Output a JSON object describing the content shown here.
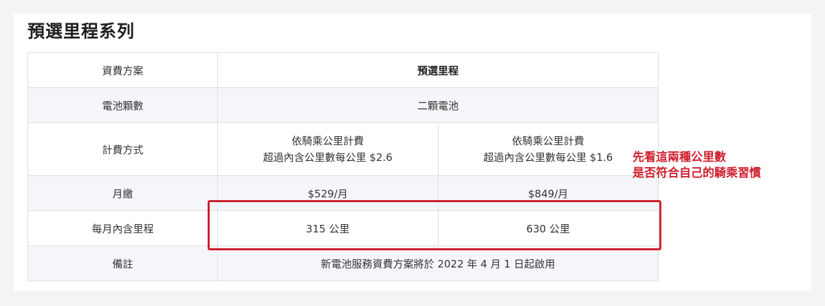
{
  "title": "預選里程系列",
  "table": {
    "rows": {
      "plan": {
        "label": "資費方案",
        "value": "預選里程"
      },
      "battery": {
        "label": "電池顆數",
        "value": "二顆電池"
      },
      "billing": {
        "label": "計費方式",
        "col1_line1": "依騎乘公里計費",
        "col1_line2": "超過內含公里數每公里 $2.6",
        "col2_line1": "依騎乘公里計費",
        "col2_line2": "超過內含公里數每公里 $1.6"
      },
      "monthly": {
        "label": "月繳",
        "col1": "$529/月",
        "col2": "$849/月"
      },
      "included": {
        "label": "每月內含里程",
        "col1": "315 公里",
        "col2": "630 公里"
      },
      "note": {
        "label": "備註",
        "value": "新電池服務資費方案將於 2022 年 4 月 1 日起啟用"
      }
    }
  },
  "annotation": {
    "line1": "先看這兩種公里數",
    "line2": "是否符合自己的騎乘習慣",
    "color": "#d0202f"
  }
}
